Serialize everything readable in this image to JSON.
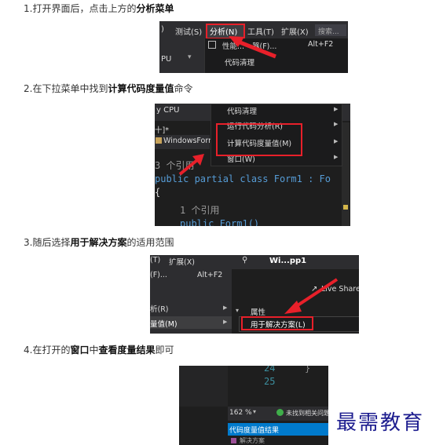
{
  "steps": [
    {
      "pre": "1.打开界面后，点击上方的",
      "bold": "分析菜单",
      "post": ""
    },
    {
      "pre": "2.在下拉菜单中找到",
      "bold": "计算代码度量值",
      "post": "命令"
    },
    {
      "pre": "3.随后选择",
      "bold": "用于解决方案",
      "post": "的适用范围"
    },
    {
      "pre": "4.在打开的",
      "bold": "窗口",
      "mid": "中",
      "bold2": "查看度量结果",
      "post": "即可"
    }
  ],
  "shot1": {
    "menubar": [
      ")",
      "测试(S)",
      "分析(N)",
      "工具(T)",
      "扩展(X)"
    ],
    "search": "搜索...",
    "item1": "性能...",
    "item1_suffix": "器(F)...",
    "shortcut": "Alt+F2",
    "item2": "代码清理",
    "cpu": "PU"
  },
  "shot2": {
    "cpu": "y CPU",
    "menu": [
      "代码清理",
      "运行代码分析(R)",
      "计算代码度量值(M)",
      "窗口(W)"
    ],
    "tab": "十]*",
    "tab2": "WindowsForm",
    "ref1": "3 个引用",
    "code1": "public partial class Form1 : Fo",
    "brace": "{",
    "ref2": "1 个引用",
    "code2": "public Form1()"
  },
  "shot3": {
    "menubar": [
      "(T)",
      "扩展(X)"
    ],
    "title": "Wi...pp1",
    "item1": "(F)...",
    "shortcut": "Alt+F2",
    "item2": "析(R)",
    "item3": "量值(M)",
    "share": "Live Share",
    "prop": "属性",
    "sub": "用于解决方案(L)"
  },
  "shot4": {
    "line1": "24",
    "line2": "25",
    "zoom": "162 %",
    "status": "未找到相关问题",
    "panel_title": "代码度量值结果",
    "panel_sub": "解决方案"
  },
  "watermark": "最需教育"
}
